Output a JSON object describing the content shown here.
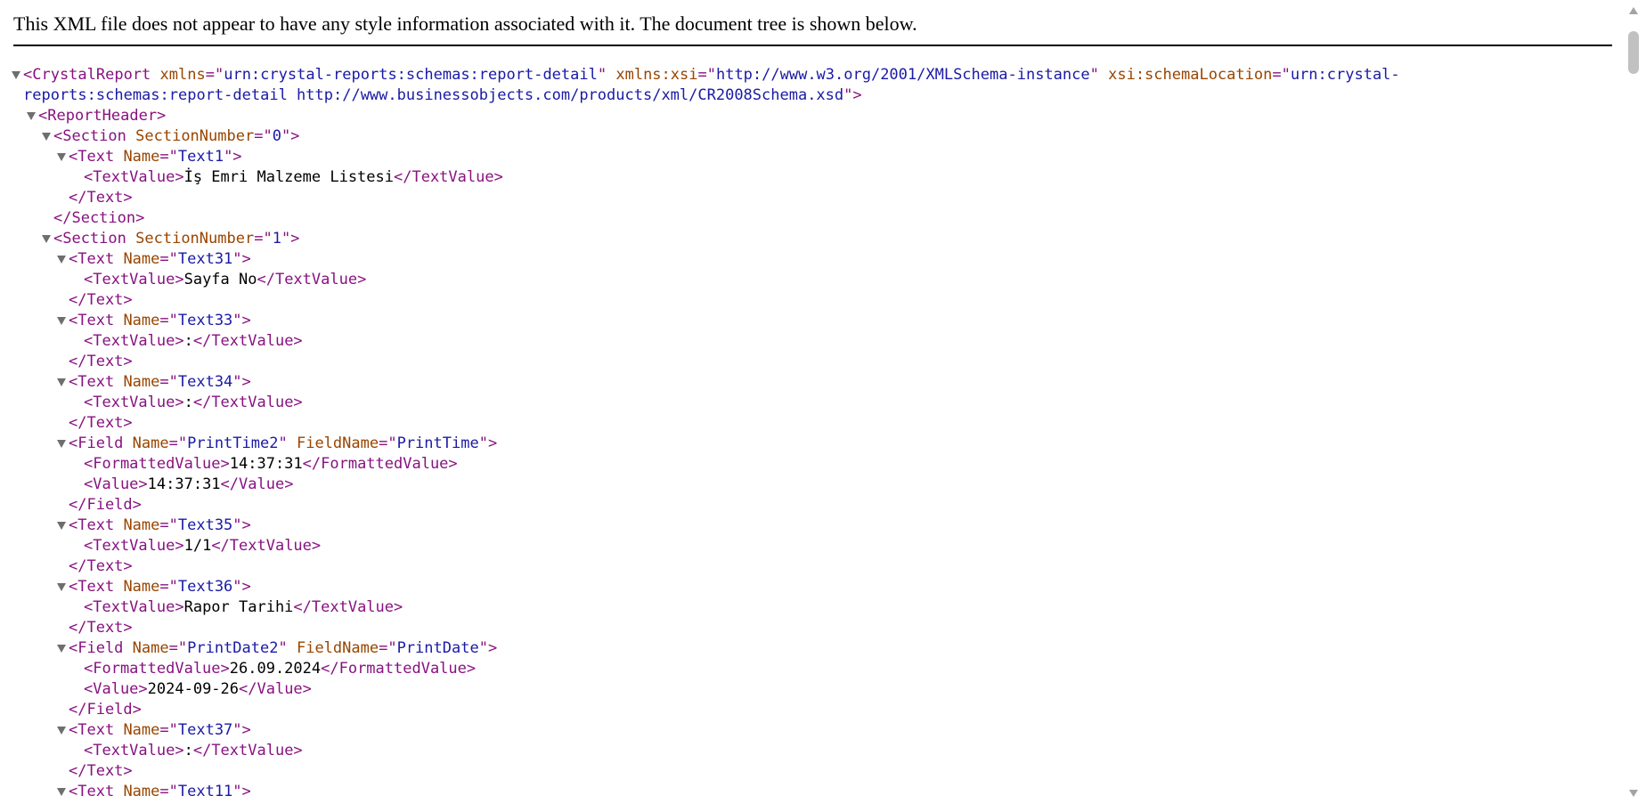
{
  "banner": {
    "text": "This XML file does not appear to have any style information associated with it. The document tree is shown below."
  },
  "colors": {
    "tag": "#881280",
    "attribute_name": "#994500",
    "attribute_value": "#1a1aa6",
    "text": "#000000"
  },
  "lines": [
    {
      "id": "l0",
      "kind": "open",
      "toggle": true,
      "segs": [
        [
          "t",
          "<CrystalReport"
        ],
        [
          "s",
          " "
        ],
        [
          "a",
          "xmlns"
        ],
        [
          "t",
          "=\""
        ],
        [
          "v",
          "urn:crystal-reports:schemas:report-detail"
        ],
        [
          "t",
          "\""
        ],
        [
          "s",
          " "
        ],
        [
          "a",
          "xmlns:xsi"
        ],
        [
          "t",
          "=\""
        ],
        [
          "v",
          "http://www.w3.org/2001/XMLSchema-instance"
        ],
        [
          "t",
          "\""
        ],
        [
          "s",
          " "
        ],
        [
          "a",
          "xsi:schemaLocation"
        ],
        [
          "t",
          "=\""
        ],
        [
          "v",
          "urn:crystal-"
        ]
      ]
    },
    {
      "id": "l1",
      "kind": "cont",
      "toggle": false,
      "segs": [
        [
          "v",
          "reports:schemas:report-detail http://www.businessobjects.com/products/xml/CR2008Schema.xsd"
        ],
        [
          "t",
          "\">"
        ]
      ]
    },
    {
      "id": "l2",
      "kind": "open",
      "toggle": true,
      "segs": [
        [
          "t",
          "<ReportHeader>"
        ]
      ]
    },
    {
      "id": "l3",
      "kind": "open",
      "toggle": true,
      "segs": [
        [
          "t",
          "<Section"
        ],
        [
          "s",
          " "
        ],
        [
          "a",
          "SectionNumber"
        ],
        [
          "t",
          "=\""
        ],
        [
          "v",
          "0"
        ],
        [
          "t",
          "\">"
        ]
      ]
    },
    {
      "id": "l4",
      "kind": "open",
      "toggle": true,
      "segs": [
        [
          "t",
          "<Text"
        ],
        [
          "s",
          " "
        ],
        [
          "a",
          "Name"
        ],
        [
          "t",
          "=\""
        ],
        [
          "v",
          "Text1"
        ],
        [
          "t",
          "\">"
        ]
      ]
    },
    {
      "id": "l5",
      "kind": "leaf",
      "toggle": false,
      "segs": [
        [
          "t",
          "<TextValue>"
        ],
        [
          "x",
          "İş Emri Malzeme Listesi"
        ],
        [
          "t",
          "</TextValue>"
        ]
      ]
    },
    {
      "id": "l6",
      "kind": "close",
      "toggle": false,
      "segs": [
        [
          "t",
          "</Text>"
        ]
      ]
    },
    {
      "id": "l7",
      "kind": "close",
      "toggle": false,
      "segs": [
        [
          "t",
          "</Section>"
        ]
      ]
    },
    {
      "id": "l8",
      "kind": "open",
      "toggle": true,
      "segs": [
        [
          "t",
          "<Section"
        ],
        [
          "s",
          " "
        ],
        [
          "a",
          "SectionNumber"
        ],
        [
          "t",
          "=\""
        ],
        [
          "v",
          "1"
        ],
        [
          "t",
          "\">"
        ]
      ]
    },
    {
      "id": "l9",
      "kind": "open",
      "toggle": true,
      "segs": [
        [
          "t",
          "<Text"
        ],
        [
          "s",
          " "
        ],
        [
          "a",
          "Name"
        ],
        [
          "t",
          "=\""
        ],
        [
          "v",
          "Text31"
        ],
        [
          "t",
          "\">"
        ]
      ]
    },
    {
      "id": "l10",
      "kind": "leaf",
      "toggle": false,
      "segs": [
        [
          "t",
          "<TextValue>"
        ],
        [
          "x",
          "Sayfa No"
        ],
        [
          "t",
          "</TextValue>"
        ]
      ]
    },
    {
      "id": "l11",
      "kind": "close",
      "toggle": false,
      "segs": [
        [
          "t",
          "</Text>"
        ]
      ]
    },
    {
      "id": "l12",
      "kind": "open",
      "toggle": true,
      "segs": [
        [
          "t",
          "<Text"
        ],
        [
          "s",
          " "
        ],
        [
          "a",
          "Name"
        ],
        [
          "t",
          "=\""
        ],
        [
          "v",
          "Text33"
        ],
        [
          "t",
          "\">"
        ]
      ]
    },
    {
      "id": "l13",
      "kind": "leaf",
      "toggle": false,
      "segs": [
        [
          "t",
          "<TextValue>"
        ],
        [
          "x",
          ":"
        ],
        [
          "t",
          "</TextValue>"
        ]
      ]
    },
    {
      "id": "l14",
      "kind": "close",
      "toggle": false,
      "segs": [
        [
          "t",
          "</Text>"
        ]
      ]
    },
    {
      "id": "l15",
      "kind": "open",
      "toggle": true,
      "segs": [
        [
          "t",
          "<Text"
        ],
        [
          "s",
          " "
        ],
        [
          "a",
          "Name"
        ],
        [
          "t",
          "=\""
        ],
        [
          "v",
          "Text34"
        ],
        [
          "t",
          "\">"
        ]
      ]
    },
    {
      "id": "l16",
      "kind": "leaf",
      "toggle": false,
      "segs": [
        [
          "t",
          "<TextValue>"
        ],
        [
          "x",
          ":"
        ],
        [
          "t",
          "</TextValue>"
        ]
      ]
    },
    {
      "id": "l17",
      "kind": "close",
      "toggle": false,
      "segs": [
        [
          "t",
          "</Text>"
        ]
      ]
    },
    {
      "id": "l18",
      "kind": "open",
      "toggle": true,
      "segs": [
        [
          "t",
          "<Field"
        ],
        [
          "s",
          " "
        ],
        [
          "a",
          "Name"
        ],
        [
          "t",
          "=\""
        ],
        [
          "v",
          "PrintTime2"
        ],
        [
          "t",
          "\""
        ],
        [
          "s",
          " "
        ],
        [
          "a",
          "FieldName"
        ],
        [
          "t",
          "=\""
        ],
        [
          "v",
          "PrintTime"
        ],
        [
          "t",
          "\">"
        ]
      ]
    },
    {
      "id": "l19",
      "kind": "leaf",
      "toggle": false,
      "segs": [
        [
          "t",
          "<FormattedValue>"
        ],
        [
          "x",
          "14:37:31"
        ],
        [
          "t",
          "</FormattedValue>"
        ]
      ]
    },
    {
      "id": "l20",
      "kind": "leaf",
      "toggle": false,
      "segs": [
        [
          "t",
          "<Value>"
        ],
        [
          "x",
          "14:37:31"
        ],
        [
          "t",
          "</Value>"
        ]
      ]
    },
    {
      "id": "l21",
      "kind": "close",
      "toggle": false,
      "segs": [
        [
          "t",
          "</Field>"
        ]
      ]
    },
    {
      "id": "l22",
      "kind": "open",
      "toggle": true,
      "segs": [
        [
          "t",
          "<Text"
        ],
        [
          "s",
          " "
        ],
        [
          "a",
          "Name"
        ],
        [
          "t",
          "=\""
        ],
        [
          "v",
          "Text35"
        ],
        [
          "t",
          "\">"
        ]
      ]
    },
    {
      "id": "l23",
      "kind": "leaf",
      "toggle": false,
      "segs": [
        [
          "t",
          "<TextValue>"
        ],
        [
          "x",
          "1/1"
        ],
        [
          "t",
          "</TextValue>"
        ]
      ]
    },
    {
      "id": "l24",
      "kind": "close",
      "toggle": false,
      "segs": [
        [
          "t",
          "</Text>"
        ]
      ]
    },
    {
      "id": "l25",
      "kind": "open",
      "toggle": true,
      "segs": [
        [
          "t",
          "<Text"
        ],
        [
          "s",
          " "
        ],
        [
          "a",
          "Name"
        ],
        [
          "t",
          "=\""
        ],
        [
          "v",
          "Text36"
        ],
        [
          "t",
          "\">"
        ]
      ]
    },
    {
      "id": "l26",
      "kind": "leaf",
      "toggle": false,
      "segs": [
        [
          "t",
          "<TextValue>"
        ],
        [
          "x",
          "Rapor Tarihi"
        ],
        [
          "t",
          "</TextValue>"
        ]
      ]
    },
    {
      "id": "l27",
      "kind": "close",
      "toggle": false,
      "segs": [
        [
          "t",
          "</Text>"
        ]
      ]
    },
    {
      "id": "l28",
      "kind": "open",
      "toggle": true,
      "segs": [
        [
          "t",
          "<Field"
        ],
        [
          "s",
          " "
        ],
        [
          "a",
          "Name"
        ],
        [
          "t",
          "=\""
        ],
        [
          "v",
          "PrintDate2"
        ],
        [
          "t",
          "\""
        ],
        [
          "s",
          " "
        ],
        [
          "a",
          "FieldName"
        ],
        [
          "t",
          "=\""
        ],
        [
          "v",
          "PrintDate"
        ],
        [
          "t",
          "\">"
        ]
      ]
    },
    {
      "id": "l29",
      "kind": "leaf",
      "toggle": false,
      "segs": [
        [
          "t",
          "<FormattedValue>"
        ],
        [
          "x",
          "26.09.2024"
        ],
        [
          "t",
          "</FormattedValue>"
        ]
      ]
    },
    {
      "id": "l30",
      "kind": "leaf",
      "toggle": false,
      "segs": [
        [
          "t",
          "<Value>"
        ],
        [
          "x",
          "2024-09-26"
        ],
        [
          "t",
          "</Value>"
        ]
      ]
    },
    {
      "id": "l31",
      "kind": "close",
      "toggle": false,
      "segs": [
        [
          "t",
          "</Field>"
        ]
      ]
    },
    {
      "id": "l32",
      "kind": "open",
      "toggle": true,
      "segs": [
        [
          "t",
          "<Text"
        ],
        [
          "s",
          " "
        ],
        [
          "a",
          "Name"
        ],
        [
          "t",
          "=\""
        ],
        [
          "v",
          "Text37"
        ],
        [
          "t",
          "\">"
        ]
      ]
    },
    {
      "id": "l33",
      "kind": "leaf",
      "toggle": false,
      "segs": [
        [
          "t",
          "<TextValue>"
        ],
        [
          "x",
          ":"
        ],
        [
          "t",
          "</TextValue>"
        ]
      ]
    },
    {
      "id": "l34",
      "kind": "close",
      "toggle": false,
      "segs": [
        [
          "t",
          "</Text>"
        ]
      ]
    },
    {
      "id": "l35",
      "kind": "open",
      "toggle": true,
      "segs": [
        [
          "t",
          "<Text"
        ],
        [
          "s",
          " "
        ],
        [
          "a",
          "Name"
        ],
        [
          "t",
          "=\""
        ],
        [
          "v",
          "Text11"
        ],
        [
          "t",
          "\">"
        ]
      ]
    }
  ]
}
